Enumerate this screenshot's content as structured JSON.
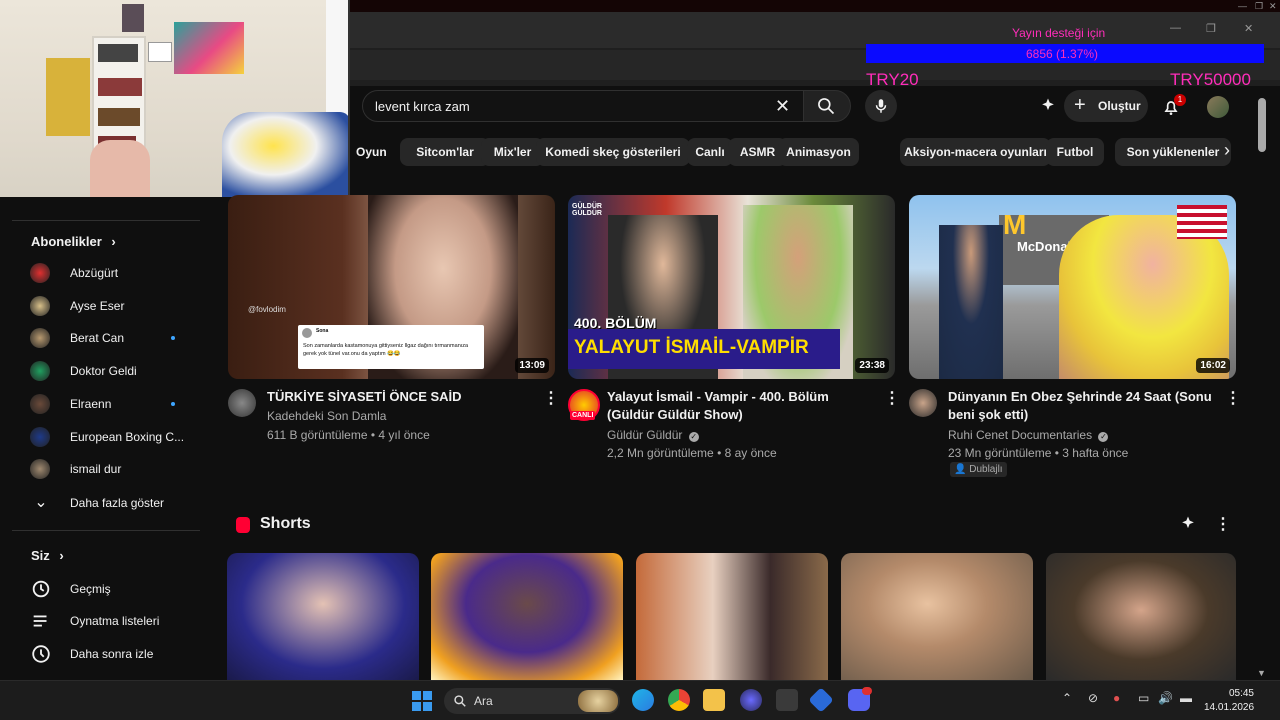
{
  "window": {
    "minimize": "—",
    "maximize": "❐",
    "close": "✕"
  },
  "donation": {
    "title": "Yayın desteği için",
    "progress_text": "6856 (1.37%)",
    "progress_fraction": 0.0137,
    "min_label": "TRY20",
    "max_label": "TRY50000",
    "color": "#ff2dba",
    "bar_color": "#0a0aff"
  },
  "header": {
    "search_value": "levent kırca zam",
    "create_label": "Oluştur",
    "notification_count": "1"
  },
  "chips": [
    "Oyun",
    "Sitcom'lar",
    "Mix'ler",
    "Komedi skeç gösterileri",
    "Canlı",
    "ASMR",
    "Animasyon",
    "Aksiyon-macera oyunları",
    "Futbol",
    "Son yüklenenler"
  ],
  "sidebar": {
    "subscriptions_title": "Abonelikler",
    "subscriptions": [
      {
        "name": "Abzügürt",
        "dot": false
      },
      {
        "name": "Ayse Eser",
        "dot": false
      },
      {
        "name": "Berat Can",
        "dot": true
      },
      {
        "name": "Doktor Geldi",
        "dot": false
      },
      {
        "name": "Elraenn",
        "dot": true
      },
      {
        "name": "European Boxing C...",
        "dot": false
      },
      {
        "name": "ismail dur",
        "dot": false
      }
    ],
    "show_more": "Daha fazla göster",
    "you_title": "Siz",
    "you_items": [
      "Geçmiş",
      "Oynatma listeleri",
      "Daha sonra izle"
    ]
  },
  "videos": [
    {
      "title": "TÜRKİYE SİYASETİ ÖNCE SAİD",
      "channel": "Kadehdeki Son Damla",
      "meta": "611 B görüntüleme • 4 yıl önce",
      "duration": "13:09",
      "thumb_caption": "@fovlodim",
      "tweet_name": "Sona",
      "tweet_text": "Son zamanlarda kastamonuya gittiyseniz Ilgaz dağını tırmanmanıza gerek yok tünel var.onu da yaptım 😂😂"
    },
    {
      "title": "Yalayut İsmail - Vampir - 400. Bölüm (Güldür Güldür Show)",
      "channel": "Güldür Güldür",
      "meta": "2,2 Mn görüntüleme • 8 ay önce",
      "duration": "23:38",
      "live_label": "CANLI",
      "episode": "400. BÖLÜM",
      "banner": "YALAYUT İSMAİL-VAMPİR",
      "show_logo": "GÜLDÜR GÜLDÜR"
    },
    {
      "title": "Dünyanın En Obez Şehrinde 24 Saat (Sonu beni şok etti)",
      "channel": "Ruhi Cenet Documentaries",
      "meta": "23 Mn görüntüleme • 3 hafta önce",
      "duration": "16:02",
      "badge": "Dublajlı",
      "sign": "McDonald's"
    }
  ],
  "shorts": {
    "title": "Shorts"
  },
  "taskbar": {
    "search_label": "Ara",
    "time": "05:45",
    "date": "14.01.2026"
  }
}
